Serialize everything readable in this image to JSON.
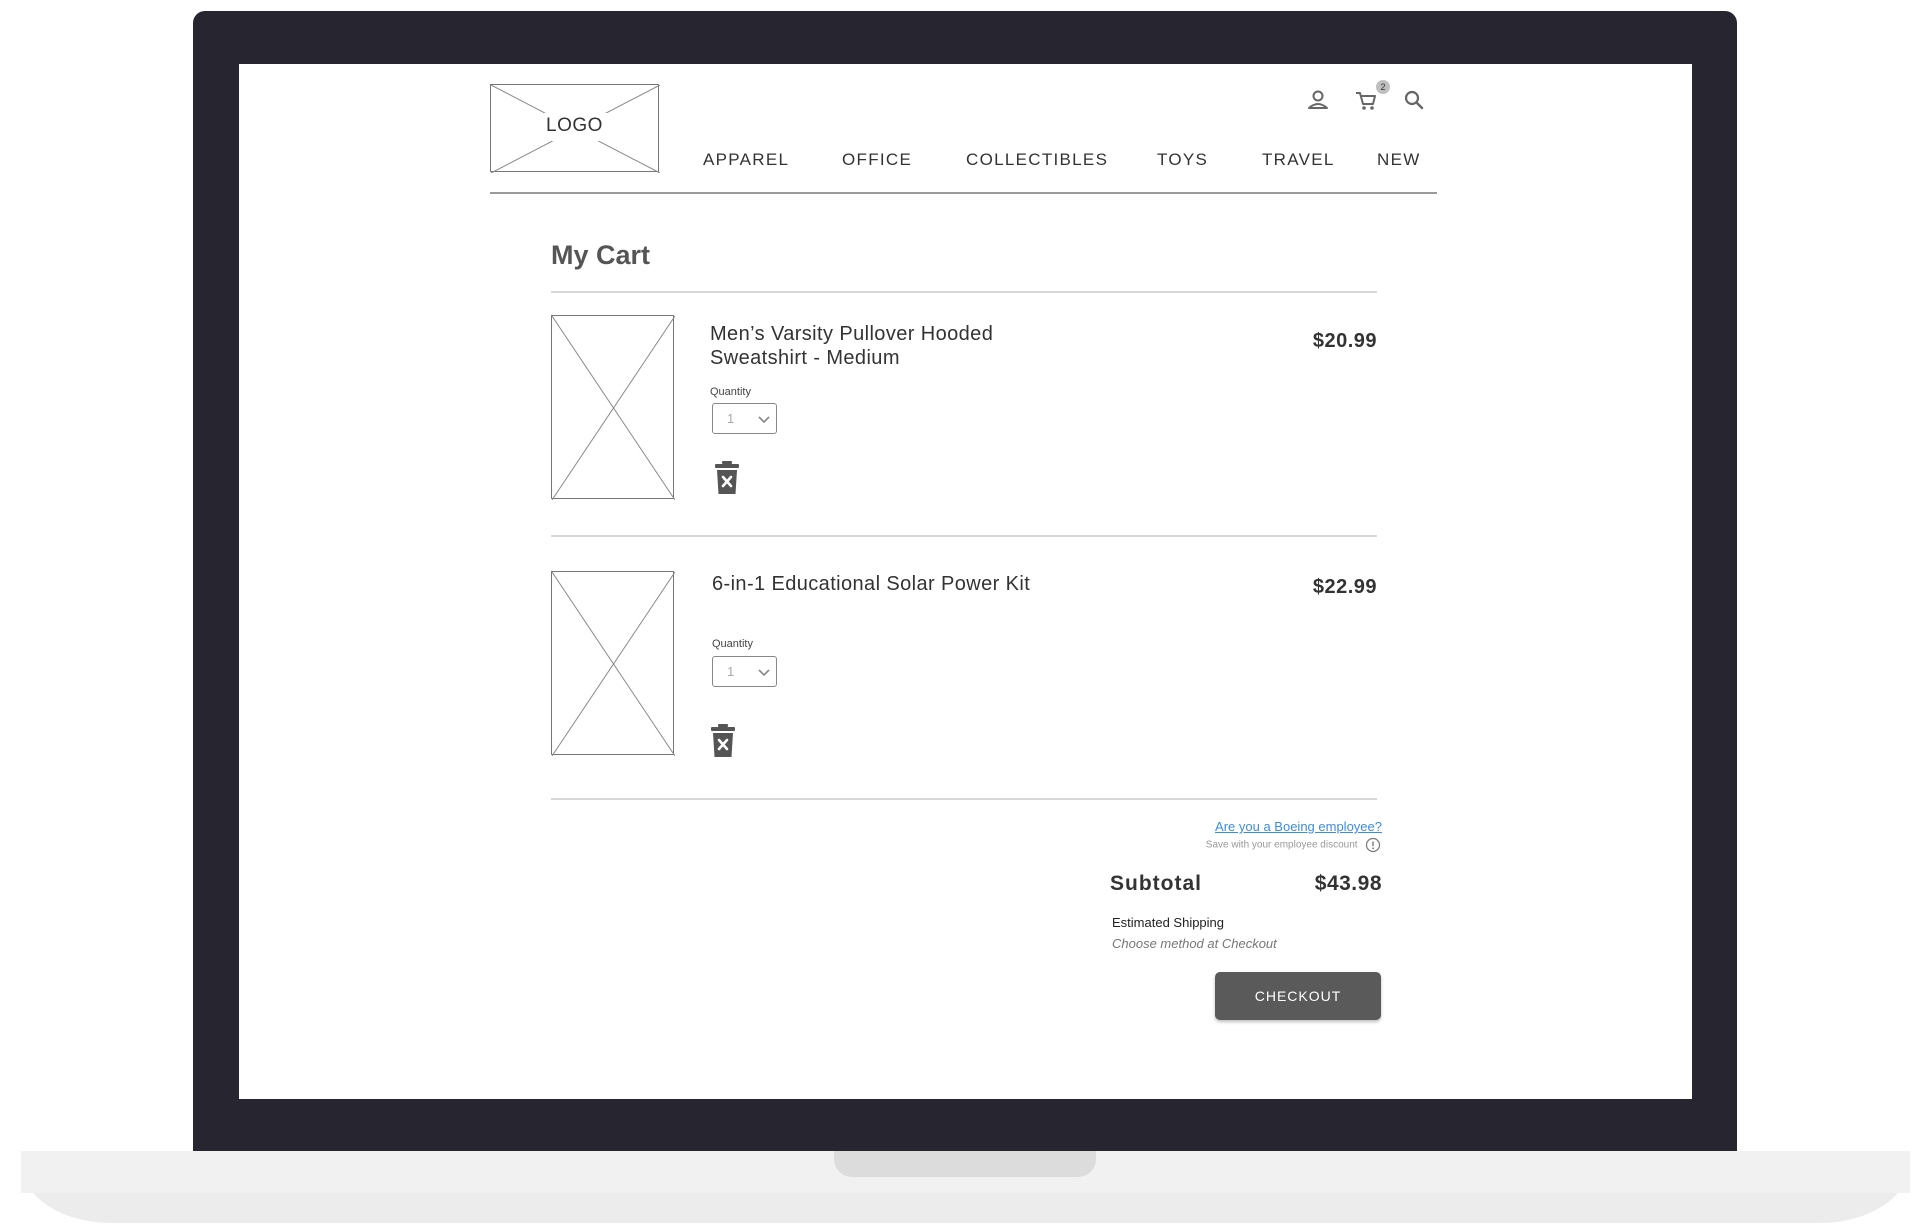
{
  "header": {
    "logo_text": "LOGO",
    "cart_count": "2",
    "nav": [
      {
        "label": "APPAREL"
      },
      {
        "label": "OFFICE"
      },
      {
        "label": "COLLECTIBLES"
      },
      {
        "label": "TOYS"
      },
      {
        "label": "TRAVEL"
      },
      {
        "label": "NEW"
      }
    ],
    "icons": [
      "user-icon",
      "cart-icon",
      "search-icon"
    ]
  },
  "cart": {
    "title": "My Cart",
    "items": [
      {
        "name": "Men’s Varsity Pullover Hooded Sweatshirt - Medium",
        "quantity_label": "Quantity",
        "quantity": "1",
        "price": "$20.99"
      },
      {
        "name": "6-in-1 Educational Solar Power Kit",
        "quantity_label": "Quantity",
        "quantity": "1",
        "price": "$22.99"
      }
    ]
  },
  "summary": {
    "employee_link": "Are you a Boeing employee?",
    "employee_note": "Save with your employee discount",
    "subtotal_label": "Subtotal",
    "subtotal_value": "$43.98",
    "shipping_label": "Estimated Shipping",
    "shipping_note": "Choose method at Checkout",
    "checkout_label": "CHECKOUT"
  },
  "colors": {
    "laptop_frame": "#262530",
    "button": "#5a5a5a",
    "link": "#3c8de0"
  }
}
